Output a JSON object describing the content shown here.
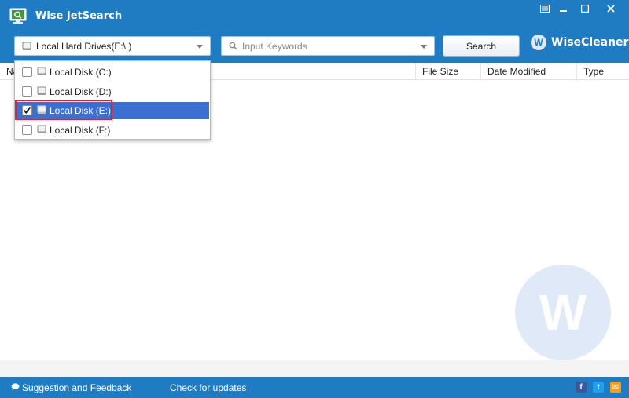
{
  "app": {
    "title": "Wise JetSearch"
  },
  "toolbar": {
    "drive_select_value": "Local Hard Drives(E:\\ )",
    "keyword_placeholder": "Input Keywords",
    "search_label": "Search",
    "brand_logo_letter": "W",
    "brand_name": "WiseCleaner"
  },
  "columns": [
    "Na",
    "File Size",
    "Date Modified",
    "Type"
  ],
  "dropdown": {
    "items": [
      {
        "label": "Local Disk (C:)",
        "checked": false
      },
      {
        "label": "Local Disk (D:)",
        "checked": false
      },
      {
        "label": "Local Disk (E:)",
        "checked": true
      },
      {
        "label": "Local Disk (F:)",
        "checked": false
      }
    ]
  },
  "watermark": {
    "letter": "W"
  },
  "footer": {
    "feedback": "Suggestion and Feedback",
    "updates": "Check for updates",
    "social": [
      "f",
      "t",
      "✉"
    ]
  },
  "colors": {
    "accent": "#1f7cc3",
    "selection": "#3b6fd0",
    "highlight": "#d8242d",
    "facebook": "#3b5998",
    "twitter": "#1da1f2",
    "mail": "#f0a020"
  },
  "icons": [
    "app-icon",
    "minimize-icon",
    "maximize-icon",
    "close-icon",
    "menu-icon",
    "drive-icon",
    "search-icon",
    "chevron-down-icon",
    "feedback-icon",
    "facebook-icon",
    "twitter-icon",
    "mail-icon"
  ]
}
